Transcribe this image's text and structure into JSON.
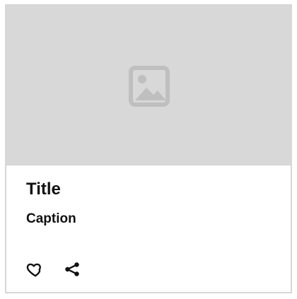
{
  "card": {
    "title": "Title",
    "caption": "Caption",
    "media_icon": "image-placeholder-icon",
    "actions": [
      {
        "icon": "heart-icon"
      },
      {
        "icon": "share-icon"
      }
    ],
    "colors": {
      "media_bg": "#d8d8d8",
      "placeholder_icon": "#bfbfbf",
      "text": "#111111",
      "border": "#d7d7d7"
    }
  }
}
